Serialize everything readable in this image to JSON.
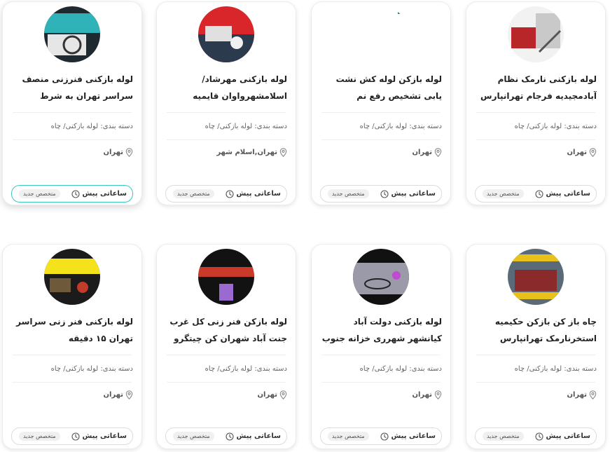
{
  "cards": [
    {
      "title": "لوله بازکنی فنرزنی منصف سراسر تهران به شرط بازشدن",
      "category": "دسته بندی: لوله بازکنی/ چاه",
      "location": "تهران",
      "time": "ساعاتی پیش",
      "badge": "متخصص جدید",
      "image_colors": [
        "#1f2a30",
        "#2fb2b8",
        "#e6e6e6"
      ]
    },
    {
      "title": "لوله بازکنی مهرشاد/اسلامشهرواوان قایمیه موسی آباد",
      "category": "دسته بندی: لوله بازکنی/ چاه",
      "location": "تهران,اسلام شهر",
      "time": "ساعاتی پیش",
      "badge": "متخصص جدید",
      "image_colors": [
        "#d8262a",
        "#2b3a4c",
        "#e0e0e0"
      ]
    },
    {
      "title": "لوله بازکن لوله کش نشت یابی تشخیص رفع نم ورطوبت",
      "category": "دسته بندی: لوله بازکنی/ چاه",
      "location": "تهران",
      "time": "ساعاتی پیش",
      "badge": "متخصص جدید",
      "image_colors": [
        "#ffffff",
        "#ffffff",
        "#2f8a3a"
      ]
    },
    {
      "title": "لوله بازکنی نارمک نظام آبادمجیدیه فرجام تهرانپارس",
      "category": "دسته بندی: لوله بازکنی/ چاه",
      "location": "تهران",
      "time": "ساعاتی پیش",
      "badge": "متخصص جدید",
      "image_colors": [
        "#c9c9c9",
        "#b8262a",
        "#f2f2f2"
      ]
    },
    {
      "title": "لوله بازکنی فنر زنی سراسر تهران ۱۵ دقیقه",
      "category": "دسته بندی: لوله بازکنی/ چاه",
      "location": "تهران",
      "time": "ساعاتی پیش",
      "badge": "متخصص جدید",
      "image_colors": [
        "#f4e21a",
        "#1b1b1b",
        "#6e5a3a"
      ]
    },
    {
      "title": "لوله بازکن فنر زنی کل غرب جنت آباد شهران کن چیتگرو",
      "category": "دسته بندی: لوله بازکنی/ چاه",
      "location": "تهران",
      "time": "ساعاتی پیش",
      "badge": "متخصص جدید",
      "image_colors": [
        "#121212",
        "#c93a2a",
        "#9a6ad0"
      ]
    },
    {
      "title": "لوله بازکنی دولت آباد کیانشهر شهرری خزانه جنوب",
      "category": "دسته بندی: لوله بازکنی/ چاه",
      "location": "تهران",
      "time": "ساعاتی پیش",
      "badge": "متخصص جدید",
      "image_colors": [
        "#111111",
        "#9a9aa8",
        "#c04ad0"
      ]
    },
    {
      "title": "چاه باز کن بازکن حکیمیه استخرنارمک تهرانپارس رسالت",
      "category": "دسته بندی: لوله بازکنی/ چاه",
      "location": "تهران",
      "time": "ساعاتی پیش",
      "badge": "متخصص جدید",
      "image_colors": [
        "#5a6a78",
        "#e8c21a",
        "#8a2a2a"
      ]
    }
  ]
}
